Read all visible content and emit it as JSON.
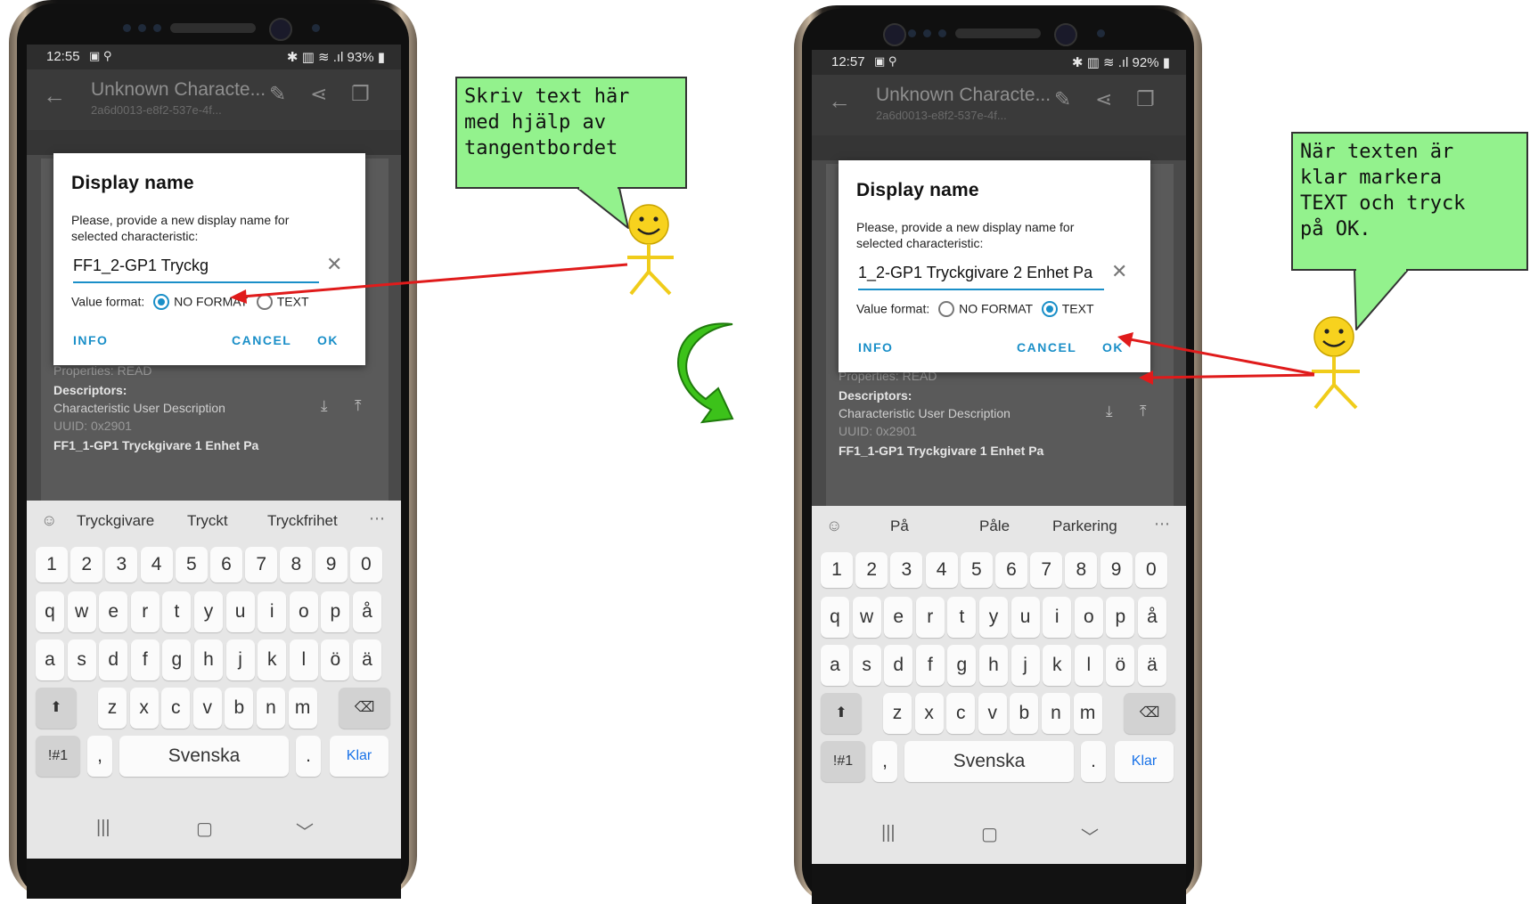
{
  "left_phone": {
    "status": {
      "time": "12:55",
      "icons": "▣ ⚲",
      "right": "✱ ▥ ≋ .ıl 93% ▮"
    },
    "appbar": {
      "title": "Unknown Characte...",
      "subtitle": "2a6d0013-e8f2-537e-4f..."
    },
    "content": {
      "properties": "Properties: READ",
      "descriptors": "Descriptors:",
      "desc_name": "Characteristic User Description",
      "uuid": "UUID: 0x2901",
      "next_item": "FF1_1-GP1 Tryckgivare 1 Enhet Pa"
    },
    "dialog": {
      "title": "Display name",
      "message": "Please, provide a new display name for selected characteristic:",
      "input_value": "FF1_2-GP1 Tryckg",
      "format_label": "Value format:",
      "opt_no_format": "NO FORMAT",
      "opt_text": "TEXT",
      "selected": "no_format",
      "info": "INFO",
      "cancel": "CANCEL",
      "ok": "OK"
    },
    "suggestions": [
      "Tryckgivare",
      "Tryckt",
      "Tryckfrihet"
    ]
  },
  "right_phone": {
    "status": {
      "time": "12:57",
      "icons": "▣ ⚲",
      "right": "✱ ▥ ≋ .ıl 92% ▮"
    },
    "appbar": {
      "title": "Unknown Characte...",
      "subtitle": "2a6d0013-e8f2-537e-4f..."
    },
    "content": {
      "properties": "Properties: READ",
      "descriptors": "Descriptors:",
      "desc_name": "Characteristic User Description",
      "uuid": "UUID: 0x2901",
      "next_item": "FF1_1-GP1 Tryckgivare 1 Enhet Pa"
    },
    "dialog": {
      "title": "Display name",
      "message": "Please, provide a new display name for selected characteristic:",
      "input_value": "1_2-GP1 Tryckgivare 2 Enhet Pa",
      "format_label": "Value format:",
      "opt_no_format": "NO FORMAT",
      "opt_text": "TEXT",
      "selected": "text",
      "info": "INFO",
      "cancel": "CANCEL",
      "ok": "OK"
    },
    "suggestions": [
      "På",
      "Påle",
      "Parkering"
    ]
  },
  "keyboard": {
    "row_numbers": [
      "1",
      "2",
      "3",
      "4",
      "5",
      "6",
      "7",
      "8",
      "9",
      "0"
    ],
    "row1": [
      "q",
      "w",
      "e",
      "r",
      "t",
      "y",
      "u",
      "i",
      "o",
      "p",
      "å"
    ],
    "row2": [
      "a",
      "s",
      "d",
      "f",
      "g",
      "h",
      "j",
      "k",
      "l",
      "ö",
      "ä"
    ],
    "row3": [
      "z",
      "x",
      "c",
      "v",
      "b",
      "n",
      "m"
    ],
    "symbols": "!#1",
    "comma": ",",
    "space": "Svenska",
    "period": ".",
    "done": "Klar"
  },
  "callouts": {
    "left": [
      "Skriv text här",
      "med hjälp av",
      "tangentbordet"
    ],
    "right": [
      "När texten är",
      "klar markera",
      "TEXT och tryck",
      "på OK."
    ]
  },
  "colors": {
    "accent": "#1a8fc8",
    "callout": "#93f28d",
    "arrow": "#e01b1b",
    "flow_arrow": "#3cc21a",
    "smiley": "#f7d21e"
  }
}
